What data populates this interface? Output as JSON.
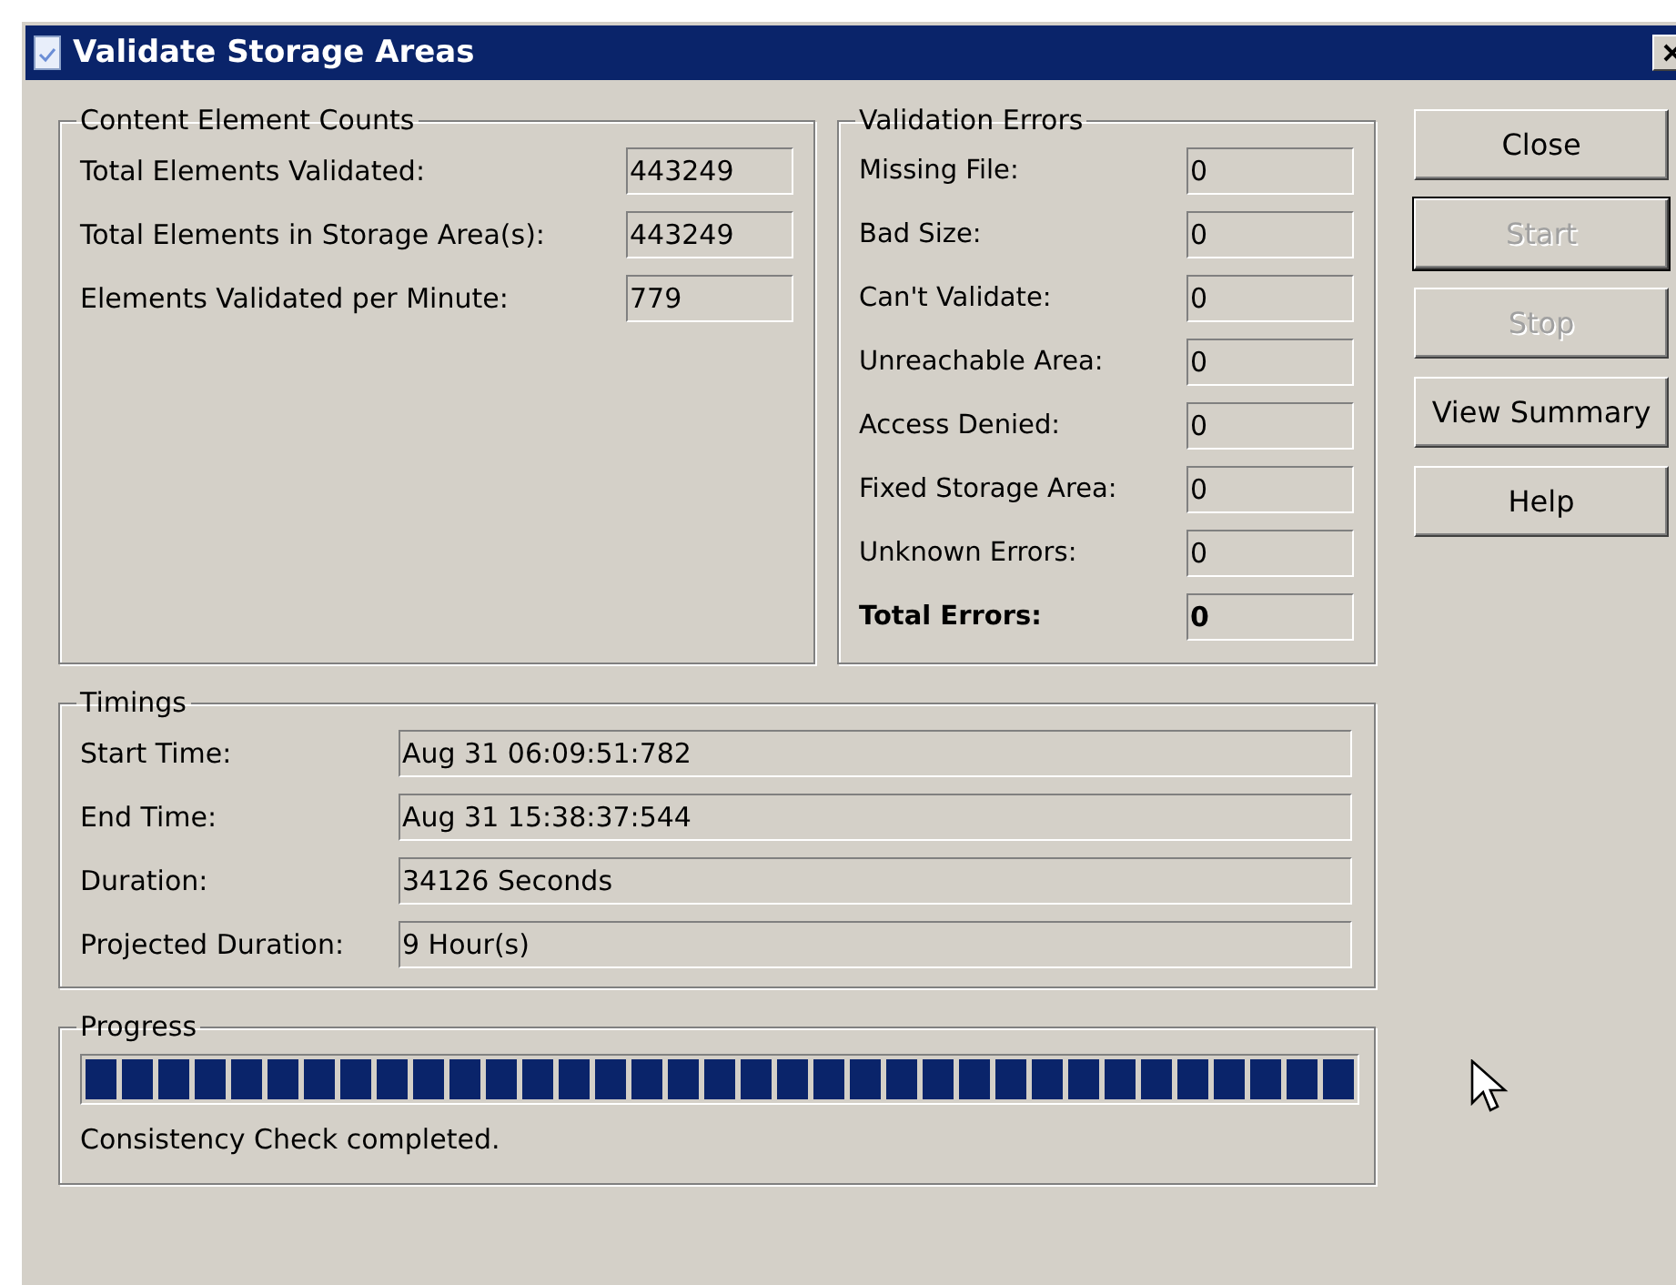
{
  "window": {
    "title": "Validate Storage Areas"
  },
  "content_element_counts": {
    "title": "Content Element Counts",
    "rows": [
      {
        "label": "Total Elements Validated:",
        "value": "443249"
      },
      {
        "label": "Total Elements in Storage Area(s):",
        "value": "443249"
      },
      {
        "label": "Elements Validated per Minute:",
        "value": "779"
      }
    ]
  },
  "validation_errors": {
    "title": "Validation Errors",
    "rows": [
      {
        "label": "Missing File:",
        "value": "0",
        "bold": false
      },
      {
        "label": "Bad Size:",
        "value": "0",
        "bold": false
      },
      {
        "label": "Can't Validate:",
        "value": "0",
        "bold": false
      },
      {
        "label": "Unreachable Area:",
        "value": "0",
        "bold": false
      },
      {
        "label": "Access Denied:",
        "value": "0",
        "bold": false
      },
      {
        "label": "Fixed Storage Area:",
        "value": "0",
        "bold": false
      },
      {
        "label": "Unknown Errors:",
        "value": "0",
        "bold": false
      },
      {
        "label": "Total Errors:",
        "value": "0",
        "bold": true
      }
    ]
  },
  "buttons": [
    {
      "label": "Close",
      "disabled": false,
      "default": false
    },
    {
      "label": "Start",
      "disabled": true,
      "default": true
    },
    {
      "label": "Stop",
      "disabled": true,
      "default": false
    },
    {
      "label": "View Summary",
      "disabled": false,
      "default": false
    },
    {
      "label": "Help",
      "disabled": false,
      "default": false
    }
  ],
  "timings": {
    "title": "Timings",
    "rows": [
      {
        "label": "Start Time:",
        "value": "Aug 31 06:09:51:782"
      },
      {
        "label": "End Time:",
        "value": "Aug 31 15:38:37:544"
      },
      {
        "label": "Duration:",
        "value": "34126 Seconds"
      },
      {
        "label": "Projected Duration:",
        "value": "9 Hour(s)"
      }
    ]
  },
  "progress": {
    "title": "Progress",
    "level": 1,
    "status": "Consistency Check completed."
  }
}
